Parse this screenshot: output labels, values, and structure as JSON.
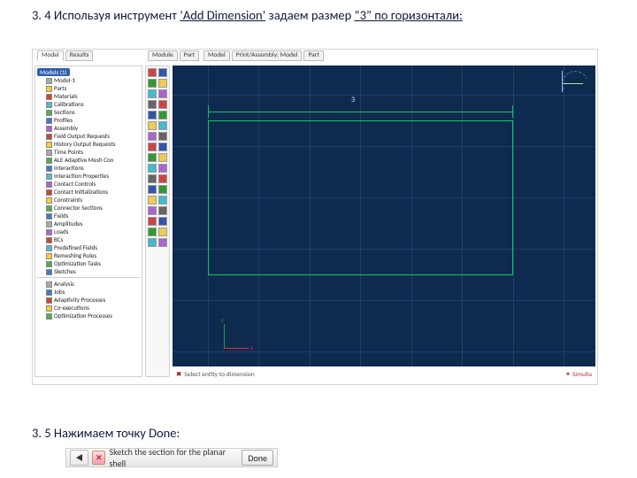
{
  "step34": {
    "number": "3. 4",
    "text_before": " Используя инструмент ",
    "tool": "‘Add Dimension’",
    "text_mid": " задаем размер ",
    "size": "“3”",
    "text_after": " по горизонтали:"
  },
  "step35": {
    "number": "3. 5",
    "text": " Нажимаем точку Done:"
  },
  "app": {
    "pane1_tabs": {
      "model": "Model",
      "results": "Results"
    },
    "pane2_tabs": {
      "module": "Module",
      "part": "Part"
    },
    "pane3_tabs": {
      "model": "Model",
      "viewport": "Print/Assembly: Model",
      "part": "Part"
    },
    "dim_label": "3",
    "status_left": "Select entity to dimension",
    "status_right": "✦ Simulia"
  },
  "tree": {
    "root": "Models (1)",
    "root_child": "Model-1",
    "items": [
      "Parts",
      "Materials",
      "Calibrations",
      "Sections",
      "Profiles",
      "Assembly",
      "Field Output Requests",
      "History Output Requests",
      "Time Points",
      "ALE Adaptive Mesh Con",
      "Interactions",
      "Interaction Properties",
      "Contact Controls",
      "Contact Initializations",
      "Constraints",
      "Connector Sections",
      "Fields",
      "Amplitudes",
      "Loads",
      "BCs",
      "Predefined Fields",
      "Remeshing Rules",
      "Optimization Tasks",
      "Sketches"
    ],
    "bottom": [
      "Analysis",
      "Jobs",
      "Adaptivity Processes",
      "Co-executions",
      "Optimization Processes"
    ]
  },
  "donebar": {
    "prompt": "Sketch the section for the planar shell",
    "done": "Done"
  }
}
